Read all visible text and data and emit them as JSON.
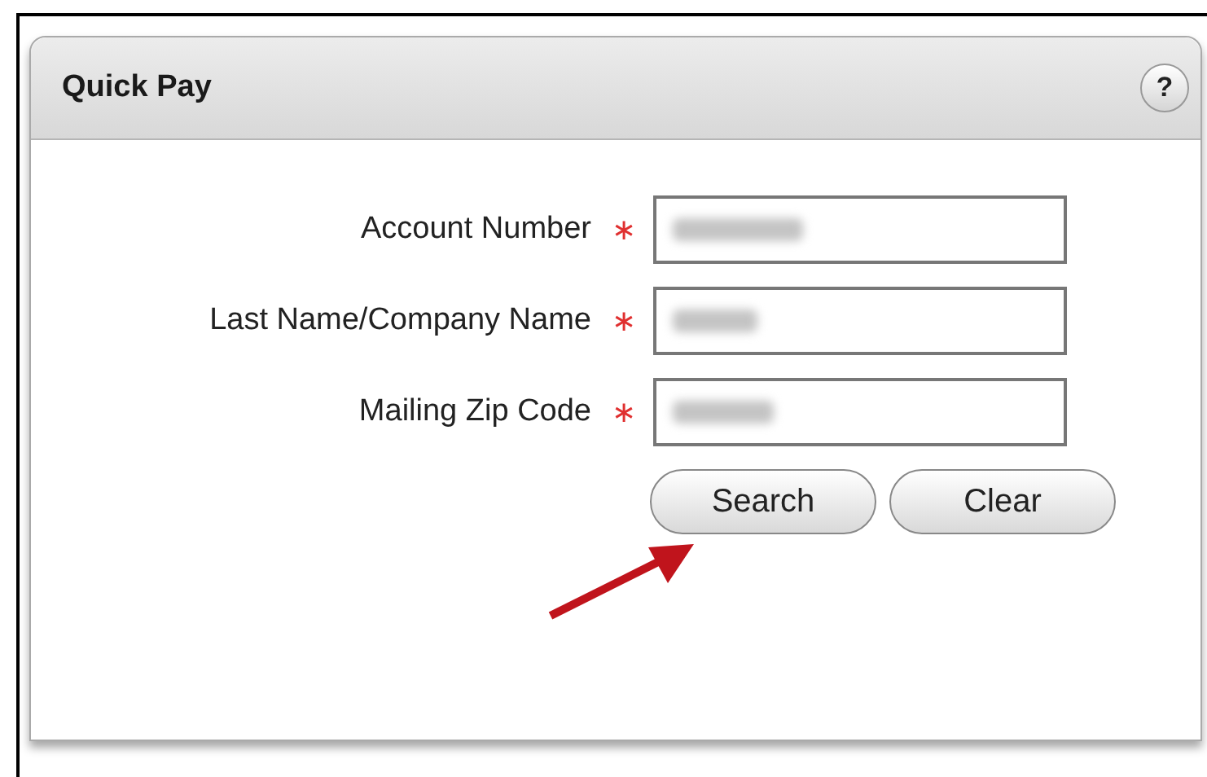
{
  "panel": {
    "title": "Quick Pay",
    "help": "?"
  },
  "fields": [
    {
      "label": "Account Number",
      "required_mark": "∗"
    },
    {
      "label": "Last Name/Company Name",
      "required_mark": "∗"
    },
    {
      "label": "Mailing Zip Code",
      "required_mark": "∗"
    }
  ],
  "buttons": [
    "Search",
    "Clear"
  ]
}
